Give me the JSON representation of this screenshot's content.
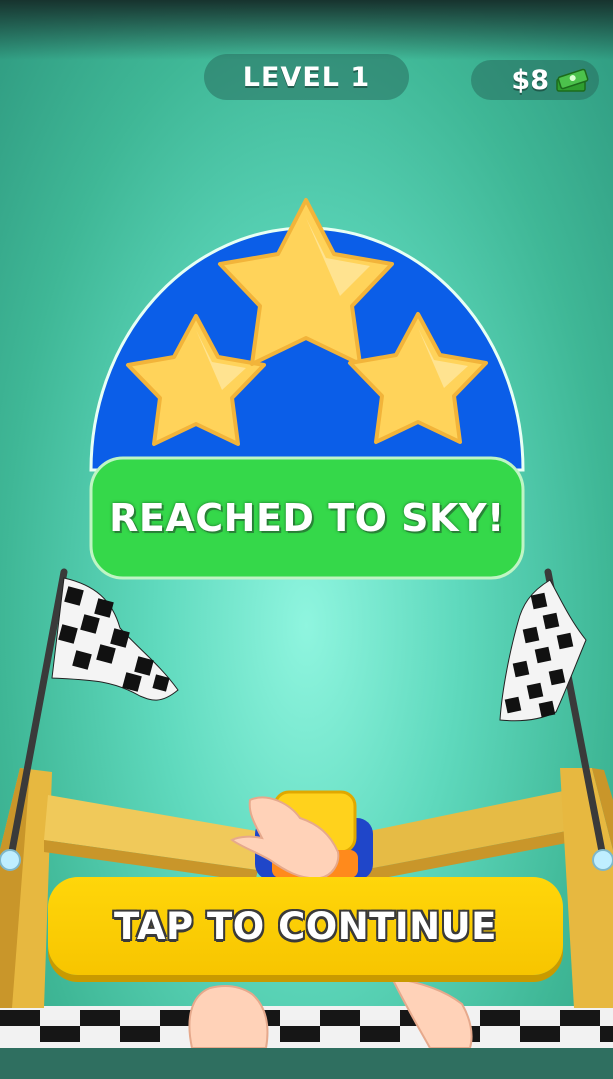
{
  "hud": {
    "level_text": "LEVEL 1",
    "money_text": "$8",
    "money_icon": "cash-stack-icon"
  },
  "result": {
    "stars_earned": 3,
    "stars_total": 3,
    "message": "REACHED TO SKY!"
  },
  "actions": {
    "continue_label": "TAP TO CONTINUE"
  },
  "colors": {
    "background": "#5fd9bd",
    "badge_blue": "#0b5ee8",
    "star_gold": "#ffd35a",
    "message_green": "#35d84a",
    "button_yellow": "#ffd60a"
  }
}
